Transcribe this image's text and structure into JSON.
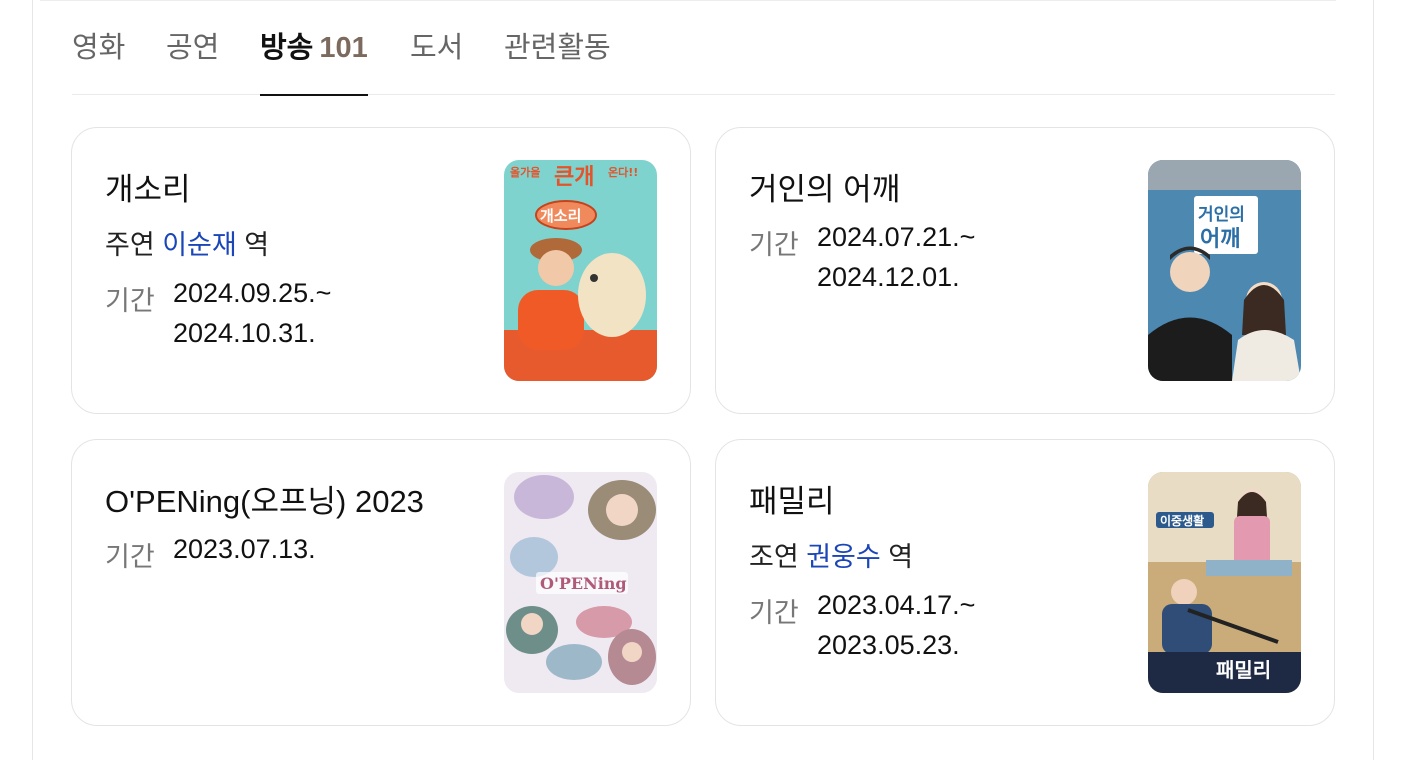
{
  "tabs": [
    {
      "label": "영화"
    },
    {
      "label": "공연"
    },
    {
      "label": "방송",
      "count": "101"
    },
    {
      "label": "도서"
    },
    {
      "label": "관련활동"
    }
  ],
  "cards": [
    {
      "title": "개소리",
      "role_prefix": "주연",
      "actor": "이순재",
      "role_suffix": "역",
      "period_label": "기간",
      "period_start": "2024.09.25.~",
      "period_end": "2024.10.31.",
      "poster_texts": {
        "top": "올가을",
        "big": "큰개",
        "top2": "온다!!",
        "logo": "개소리"
      }
    },
    {
      "title": "거인의 어깨",
      "period_label": "기간",
      "period_start": "2024.07.21.~",
      "period_end": "2024.12.01.",
      "poster_texts": {
        "line1": "거인의",
        "line2": "어깨"
      }
    },
    {
      "title": "O'PENing(오프닝) 2023",
      "period_label": "기간",
      "period_start": "2023.07.13.",
      "poster_texts": {
        "logo": "O'PENing"
      }
    },
    {
      "title": "패밀리",
      "role_prefix": "조연",
      "actor": "권웅수",
      "role_suffix": "역",
      "period_label": "기간",
      "period_start": "2023.04.17.~",
      "period_end": "2023.05.23.",
      "poster_texts": {
        "tag": "이중생활",
        "logo": "패밀리"
      }
    }
  ],
  "colors": {
    "actor_link": "#1b46b8",
    "tab_count": "#7c6a5f"
  }
}
